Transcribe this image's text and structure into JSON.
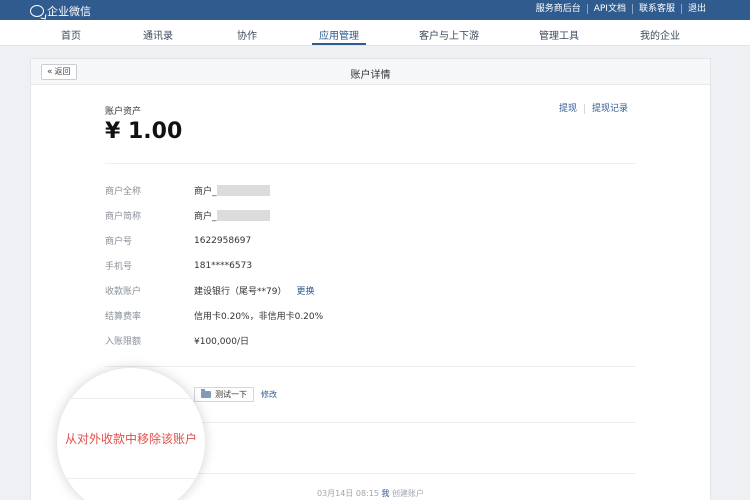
{
  "topbar": {
    "app_name": "企业微信",
    "links": [
      "服务商后台",
      "API文档",
      "联系客服",
      "退出"
    ]
  },
  "nav": {
    "items": [
      "首页",
      "通讯录",
      "协作",
      "应用管理",
      "客户与上下游",
      "管理工具",
      "我的企业"
    ],
    "active": "应用管理"
  },
  "card": {
    "back_label": "返回",
    "title": "账户详情"
  },
  "asset": {
    "label": "账户资产",
    "value": "¥ 1.00",
    "actions": [
      "提现",
      "提现记录"
    ]
  },
  "details": [
    {
      "label": "商户全称",
      "value": "商户_"
    },
    {
      "label": "商户简称",
      "value": "商户_"
    },
    {
      "label": "商户号",
      "value": "1622958697"
    },
    {
      "label": "手机号",
      "value": "181****6573"
    },
    {
      "label": "收款账户",
      "value": "建设银行（尾号**79）",
      "link": "更换"
    },
    {
      "label": "结算费率",
      "value": "信用卡0.20%，非信用卡0.20%"
    },
    {
      "label": "入账限额",
      "value": "¥100,000/日"
    }
  ],
  "tag": {
    "label": "测试一下",
    "edit": "修改"
  },
  "remove_action": "从对外收款中移除该账户",
  "footer": {
    "time": "03月14日 08:15",
    "who": "我",
    "action": "创建账户"
  },
  "colors": {
    "brand": "#2f5b8f",
    "danger": "#e0504a"
  }
}
